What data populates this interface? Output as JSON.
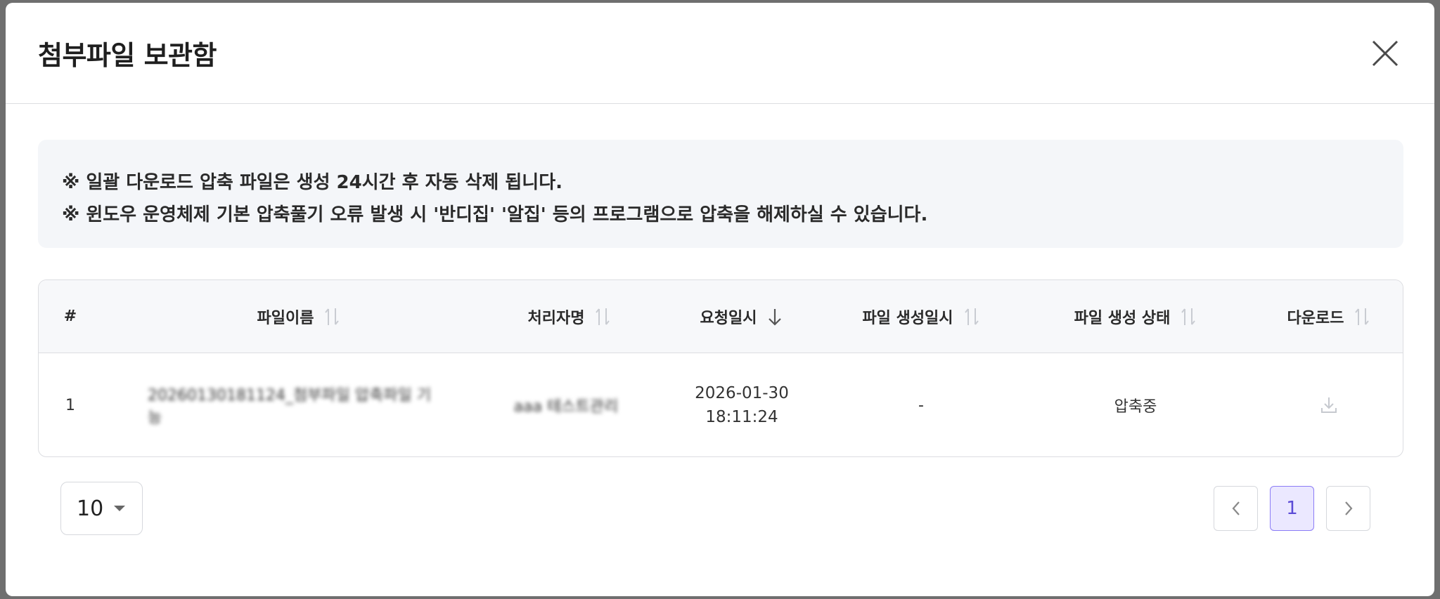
{
  "modal": {
    "title": "첨부파일 보관함"
  },
  "notice": {
    "line1": "※ 일괄 다운로드 압축 파일은 생성 24시간 후 자동 삭제 됩니다.",
    "line2": "※ 윈도우 운영체제 기본 압축풀기 오류 발생 시 '반디집' '알집' 등의 프로그램으로 압축을 해제하실 수 있습니다."
  },
  "table": {
    "headers": [
      "#",
      "파일이름",
      "처리자명",
      "요청일시",
      "파일 생성일시",
      "파일 생성 상태",
      "다운로드"
    ],
    "rows": [
      {
        "index": "1",
        "filename": "20260130181124_첨부파일 압축파일 기능",
        "processor": "aaa 테스트관리",
        "requested_date": "2026-01-30",
        "requested_time": "18:11:24",
        "created_at": "-",
        "status": "압축중"
      }
    ]
  },
  "pagination": {
    "page_size": "10",
    "current_page": "1"
  },
  "colors": {
    "accent": "#5b4bd6",
    "accent_bg": "#ebe8ff",
    "notice_bg": "#f4f6f9",
    "header_bg": "#f7f8fa"
  },
  "icons": {
    "close": "close-icon",
    "sort": "sort-icon",
    "sort_desc": "arrow-down-icon",
    "download": "download-icon",
    "prev": "chevron-left-icon",
    "next": "chevron-right-icon",
    "dropdown": "caret-down-icon"
  }
}
